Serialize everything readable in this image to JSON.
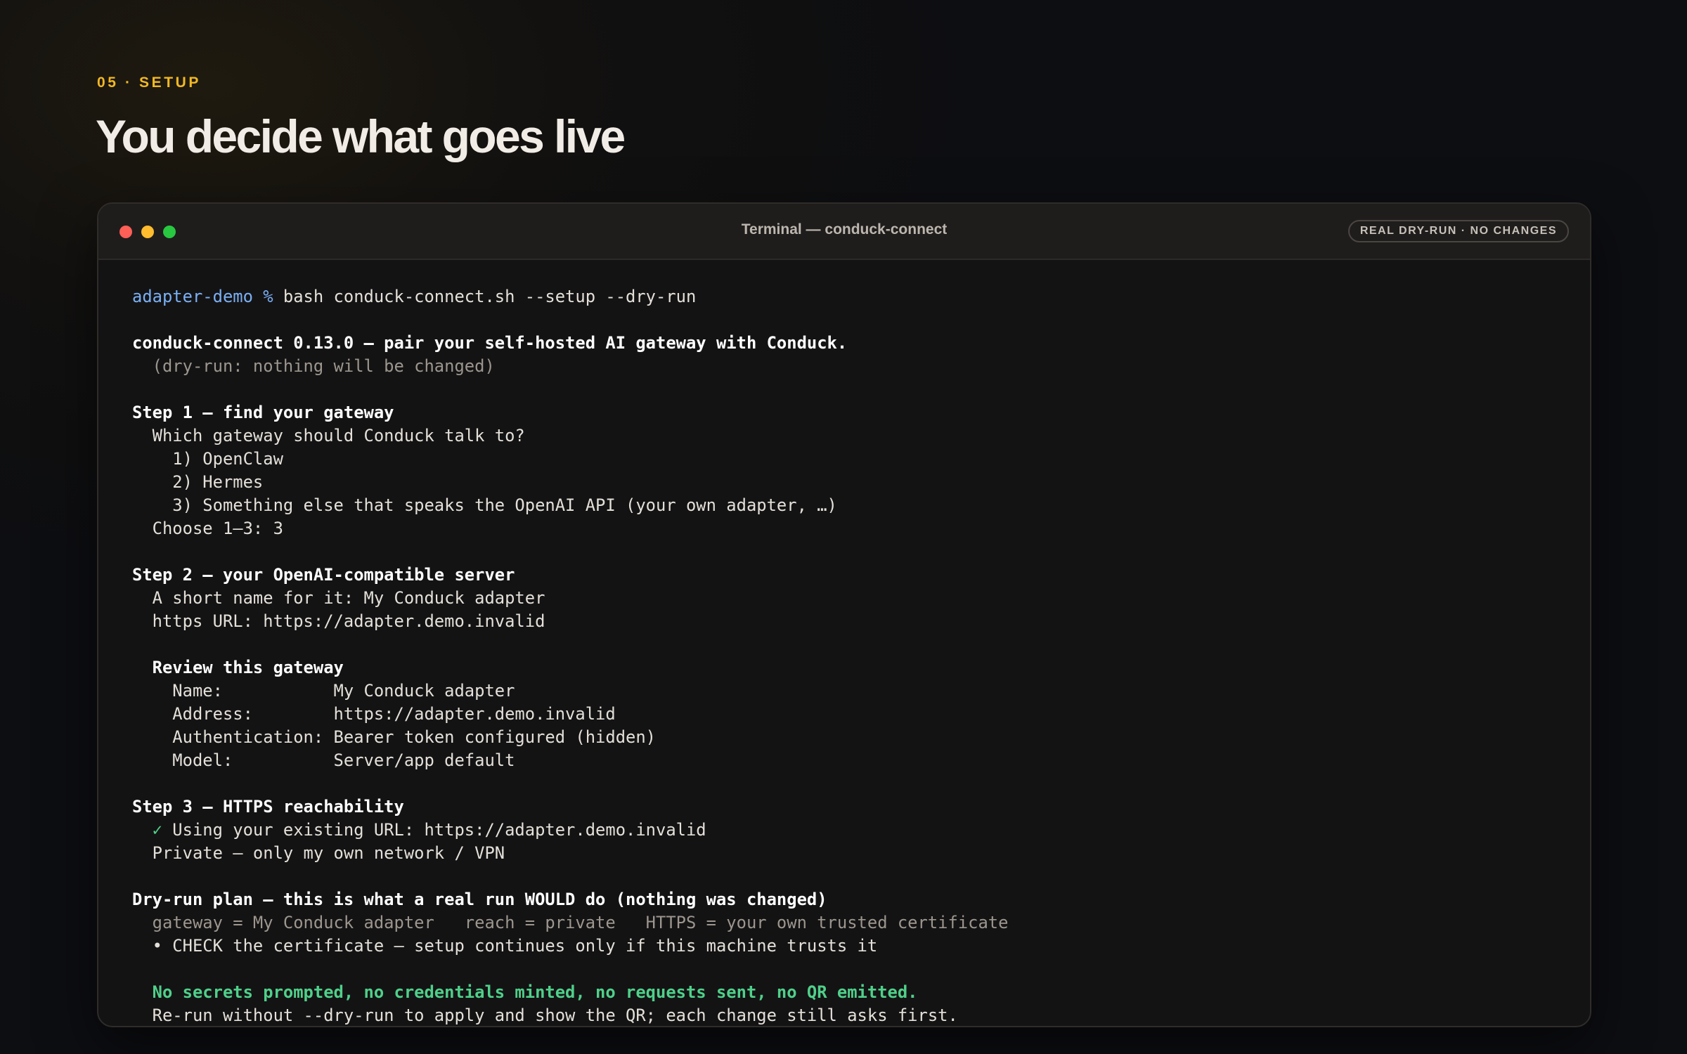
{
  "slide": {
    "eyebrow": "05 · SETUP",
    "title": "You decide what goes live"
  },
  "window": {
    "title": "Terminal — conduck-connect",
    "badge": "REAL DRY-RUN · NO CHANGES",
    "controls": [
      "close",
      "minimize",
      "zoom"
    ]
  },
  "terminal": {
    "prompt": {
      "host": "adapter-demo %",
      "command": " bash conduck-connect.sh --setup --dry-run"
    },
    "header": "conduck-connect 0.13.0 — pair your self-hosted AI gateway with Conduck.",
    "dryrun_note": "  (dry-run: nothing will be changed)",
    "step1": {
      "heading": "Step 1 — find your gateway",
      "question": "  Which gateway should Conduck talk to?",
      "options": [
        "    1) OpenClaw",
        "    2) Hermes",
        "    3) Something else that speaks the OpenAI API (your own adapter, …)"
      ],
      "choice": "  Choose 1–3: 3"
    },
    "step2": {
      "heading": "Step 2 — your OpenAI-compatible server",
      "name_line": "  A short name for it: My Conduck adapter",
      "url_line": "  https URL: https://adapter.demo.invalid",
      "review_heading": "  Review this gateway",
      "review_rows": [
        "    Name:           My Conduck adapter",
        "    Address:        https://adapter.demo.invalid",
        "    Authentication: Bearer token configured (hidden)",
        "    Model:          Server/app default"
      ]
    },
    "step3": {
      "heading": "Step 3 — HTTPS reachability",
      "check_mark": "✓",
      "existing_url": " Using your existing URL: https://adapter.demo.invalid",
      "private_line": "  Private — only my own network / VPN"
    },
    "plan": {
      "heading": "Dry-run plan — this is what a real run WOULD do (nothing was changed)",
      "summary": "  gateway = My Conduck adapter   reach = private   HTTPS = your own trusted certificate",
      "bullet": "  • CHECK the certificate — setup continues only if this machine trusts it",
      "safety": "  No secrets prompted, no credentials minted, no requests sent, no QR emitted.",
      "rerun": "  Re-run without --dry-run to apply and show the QR; each change still asks first."
    }
  },
  "colors": {
    "accent": "#f2b824",
    "prompt_host": "#7ab0f4",
    "success": "#4fd08a"
  }
}
